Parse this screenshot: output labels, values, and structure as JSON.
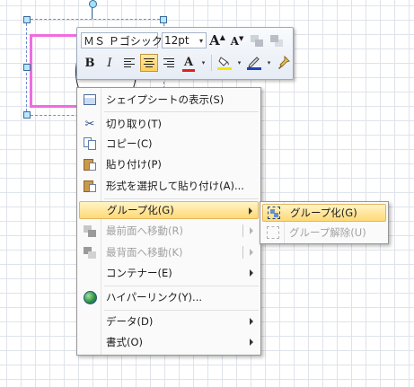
{
  "toolbar": {
    "font_name": "ＭＳ Ｐゴシック",
    "font_size": "12pt",
    "grow_icon": "grow-font-icon",
    "shrink_icon": "shrink-font-icon",
    "bold": "B",
    "italic": "I",
    "font_color_letter": "A",
    "font_color": "#e02020",
    "fill_color": "#f5e600",
    "line_color": "#1f3fbf"
  },
  "context_menu": {
    "shape_sheet": "シェイプシートの表示(S)",
    "cut": "切り取り(T)",
    "copy": "コピー(C)",
    "paste": "貼り付け(P)",
    "paste_special": "形式を選択して貼り付け(A)...",
    "group": "グループ化(G)",
    "bring_front": "最前面へ移動(R)",
    "send_back": "最背面へ移動(K)",
    "container": "コンテナー(E)",
    "hyperlink": "ハイパーリンク(Y)...",
    "data": "データ(D)",
    "format": "書式(O)"
  },
  "submenu": {
    "group": "グループ化(G)",
    "ungroup": "グループ解除(U)"
  }
}
